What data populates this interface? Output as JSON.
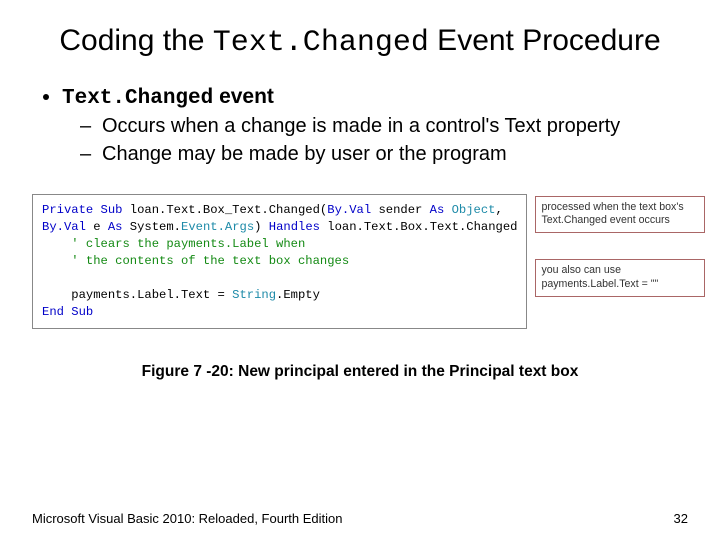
{
  "title": {
    "pre": "Coding the ",
    "mono": "Text.Changed",
    "post": " Event Procedure"
  },
  "bullet": {
    "mono": "Text.Changed",
    "bold": " event",
    "sub1": "Occurs when a change is made in a control's Text property",
    "sub2": "Change may be made by user or the program"
  },
  "code": {
    "l1a": "Private Sub",
    "l1b": " loan.Text.Box_Text.Changed(",
    "l1c": "By.Val",
    "l1d": " sender ",
    "l1e": "As ",
    "l1f": "Object",
    "l1g": ",",
    "l2a": "By.Val",
    "l2b": " e ",
    "l2c": "As",
    "l2d": " System.",
    "l2e": "Event.Args",
    "l2f": ") ",
    "l2g": "Handles",
    "l2h": " loan.Text.Box.Text.Changed",
    "l3": "    ' clears the payments.Label when",
    "l4": "    ' the contents of the text box changes",
    "l5": "",
    "l6a": "    payments.Label.Text = ",
    "l6b": "String",
    "l6c": ".Empty",
    "l7": "End Sub"
  },
  "notes": {
    "n1": "processed when the text box's Text.Changed event occurs",
    "n2": "you also can use payments.Label.Text = \"\""
  },
  "caption": "Figure 7 -20: New principal entered in the Principal text box",
  "footer": {
    "left": "Microsoft Visual Basic 2010: Reloaded, Fourth Edition",
    "right": "32"
  }
}
